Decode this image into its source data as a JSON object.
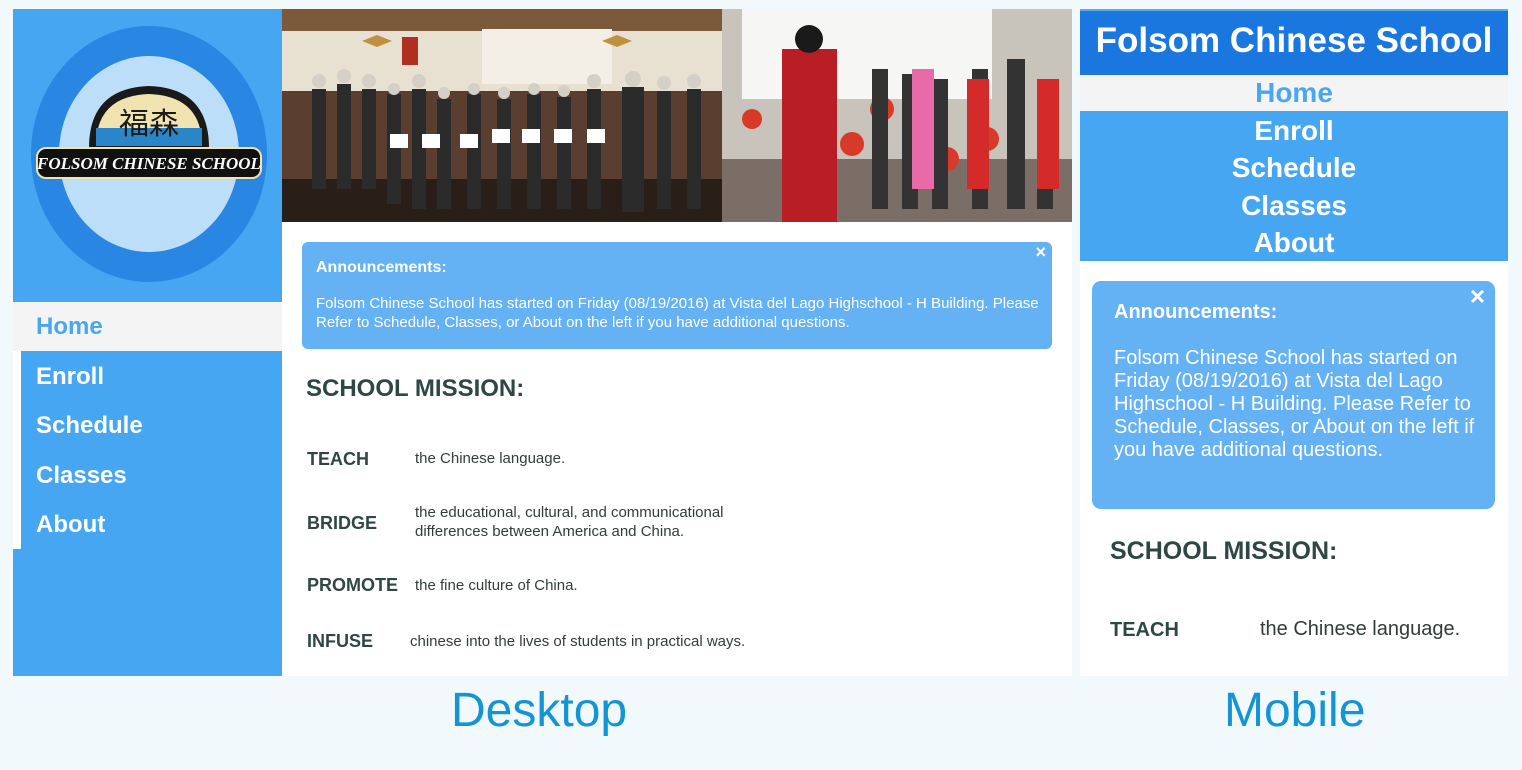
{
  "desktop": {
    "logo_text": "FOLSOM CHINESE SCHOOL",
    "logo_chinese": "福森",
    "nav": [
      "Home",
      "Enroll",
      "Schedule",
      "Classes",
      "About"
    ],
    "announcement": {
      "title": "Announcements:",
      "body": "Folsom Chinese School has started on Friday (08/19/2016) at Vista del Lago Highschool - H Building. Please Refer to Schedule, Classes, or About on the left if you have additional questions.",
      "close": "×"
    },
    "mission_title": "SCHOOL MISSION:",
    "mission": [
      {
        "key": "TEACH",
        "value": "the Chinese language."
      },
      {
        "key": "BRIDGE",
        "value": "the educational, cultural, and communicational differences between America and China."
      },
      {
        "key": "PROMOTE",
        "value": "the fine culture of China."
      },
      {
        "key": "INFUSE",
        "value": "chinese into the lives of students in practical ways."
      }
    ]
  },
  "mobile": {
    "title": "Folsom Chinese School",
    "nav": [
      "Home",
      "Enroll",
      "Schedule",
      "Classes",
      "About"
    ],
    "announcement": {
      "title": "Announcements:",
      "body": "Folsom Chinese School has started on Friday (08/19/2016) at Vista del Lago Highschool - H Building. Please Refer to Schedule, Classes, or About on the left if you have additional questions.",
      "close": "×"
    },
    "mission_title": "SCHOOL MISSION:",
    "mission": [
      {
        "key": "TEACH",
        "value": "the Chinese language."
      }
    ]
  },
  "captions": {
    "desktop": "Desktop",
    "mobile": "Mobile"
  },
  "colors": {
    "sidebar": "#46a6f1",
    "header_dark": "#1a77e0",
    "announce": "#64b1f4",
    "caption": "#1594d4",
    "nav_active": "#4aa6ee"
  }
}
